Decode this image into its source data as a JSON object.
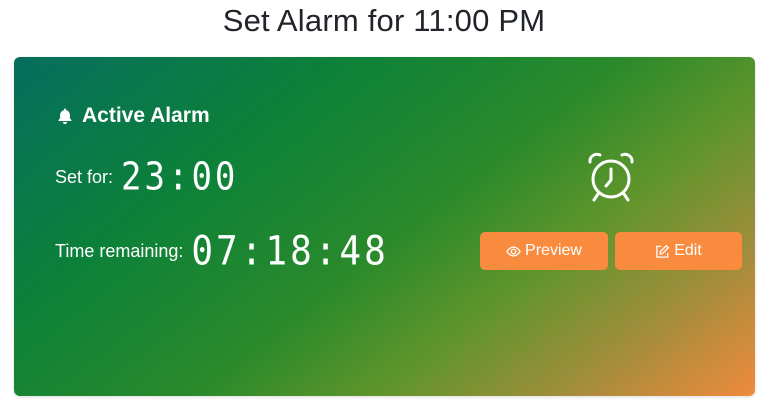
{
  "page": {
    "title": "Set Alarm for 11:00 PM"
  },
  "card": {
    "heading": "Active Alarm",
    "set_for_label": "Set for:",
    "set_for_value": "23:00",
    "remaining_label": "Time remaining:",
    "remaining_value": "07:18:48",
    "icons": {
      "heading": "bell-icon",
      "status": "alarm-clock-icon",
      "preview": "eye-icon",
      "edit": "edit-icon"
    },
    "colors": {
      "gradient_start": "#066e5e",
      "gradient_mid": "#2a8a2b",
      "gradient_end": "#f08a3c",
      "button": "#f98b3f"
    }
  },
  "actions": {
    "preview_label": "Preview",
    "edit_label": "Edit"
  }
}
